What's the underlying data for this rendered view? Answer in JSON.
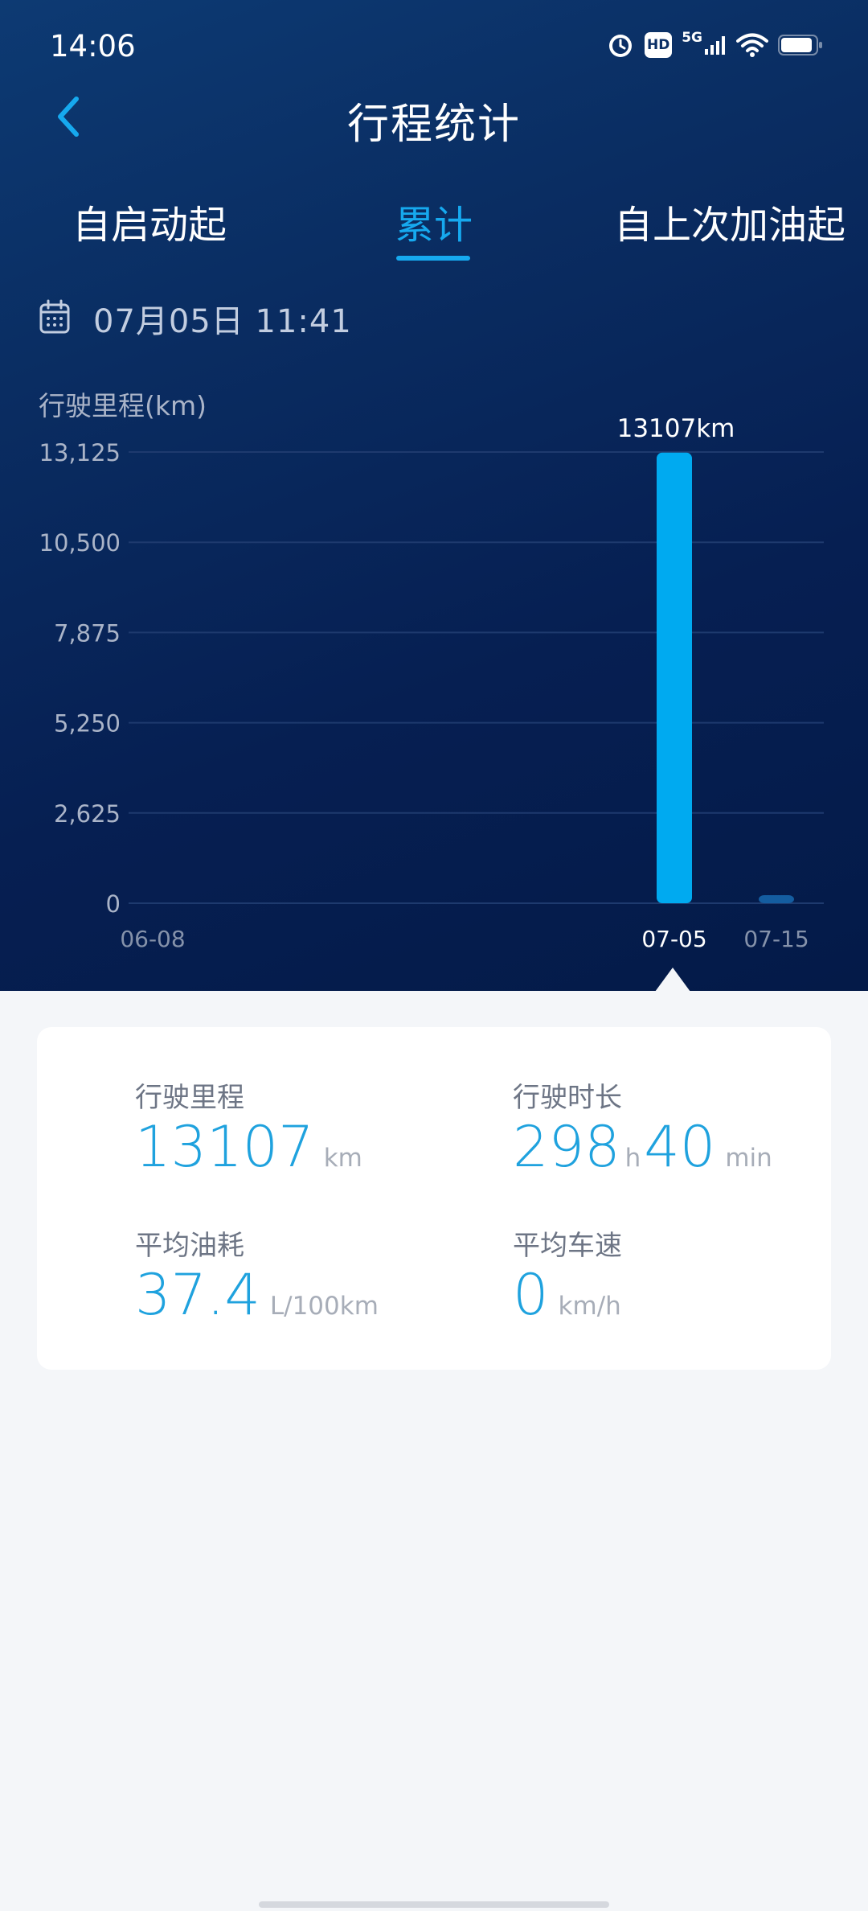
{
  "status_bar": {
    "time": "14:06",
    "icons": [
      "alarm-icon",
      "hd-icon",
      "signal-5g-icon",
      "wifi-icon",
      "battery-icon"
    ],
    "hd_label": "HD",
    "network_label": "5G"
  },
  "header": {
    "title": "行程统计",
    "back_icon": "chevron-left-icon"
  },
  "tabs": [
    {
      "label": "自启动起",
      "active": false
    },
    {
      "label": "累计",
      "active": true
    },
    {
      "label": "自上次加油起",
      "active": false
    }
  ],
  "date": {
    "icon": "calendar-icon",
    "text": "07月05日 11:41"
  },
  "chart_data": {
    "type": "bar",
    "ylabel": "行驶里程(km)",
    "ylim": [
      0,
      13125
    ],
    "yticks": [
      0,
      2625,
      5250,
      7875,
      10500,
      13125
    ],
    "ytick_labels": [
      "0",
      "2,625",
      "5,250",
      "7,875",
      "10,500",
      "13,125"
    ],
    "x_labels": [
      "06-08",
      "07-05",
      "07-15"
    ],
    "bars": [
      {
        "x": "07-05",
        "value": 13107,
        "label": "13107km",
        "selected": true
      },
      {
        "x": "07-15",
        "value": 150,
        "selected": false
      }
    ],
    "grid": true,
    "colors": {
      "selected": "#00aaf0",
      "unselected": "#145da0",
      "grid": "#1e3a6e",
      "tick": "#aab4c8"
    }
  },
  "stats": {
    "distance": {
      "label": "行驶里程",
      "value": "13107",
      "unit": "km"
    },
    "duration": {
      "label": "行驶时长",
      "hours": "298",
      "hours_unit": "h",
      "minutes": "40",
      "minutes_unit": "min"
    },
    "fuel": {
      "label": "平均油耗",
      "value": "37.4",
      "unit": "L/100km"
    },
    "speed": {
      "label": "平均车速",
      "value": "0",
      "unit": "km/h"
    }
  },
  "colors": {
    "accent": "#16a9ef",
    "hero_bg": "#062458",
    "value": "#1fa2de"
  }
}
